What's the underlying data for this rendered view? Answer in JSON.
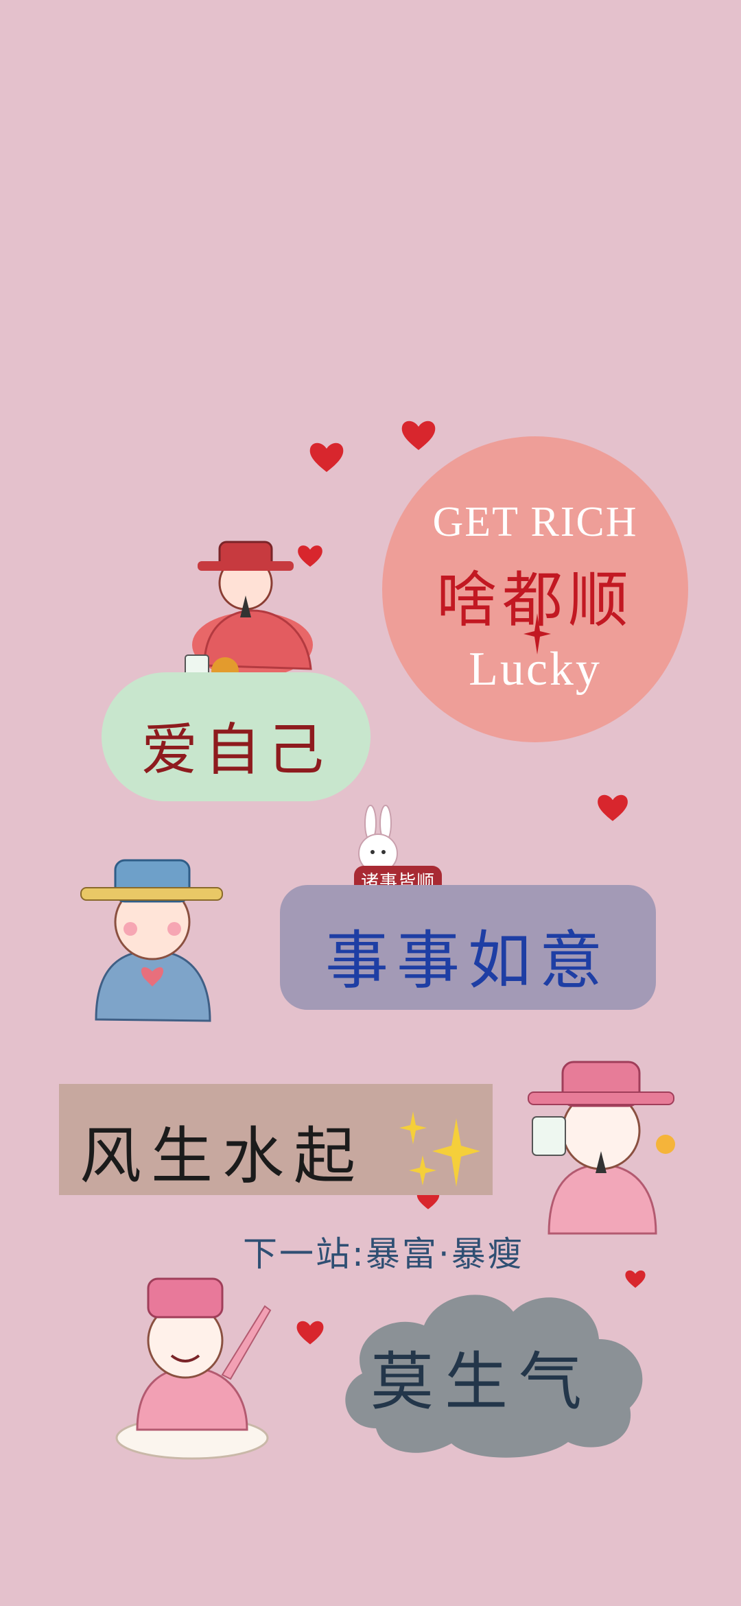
{
  "wallpaper": {
    "background_color": "#e4c1cc",
    "circle_badge": {
      "line1": "GET RICH",
      "line2": "啥都顺",
      "line3": "Lucky",
      "color": "#ee9e98"
    },
    "love_badge": {
      "text": "爱自己",
      "color": "#c8e6cd"
    },
    "wish_badge": {
      "tag": "诸事皆顺",
      "text": "事事如意",
      "color": "#a39ab6"
    },
    "fengshui_badge": {
      "text": "风生水起",
      "color": "#c7a89f"
    },
    "next_stop": "下一站:暴富·暴瘦",
    "cloud_badge": {
      "text": "莫生气",
      "color": "#8b9196"
    },
    "heart_color": "#d8262d"
  }
}
